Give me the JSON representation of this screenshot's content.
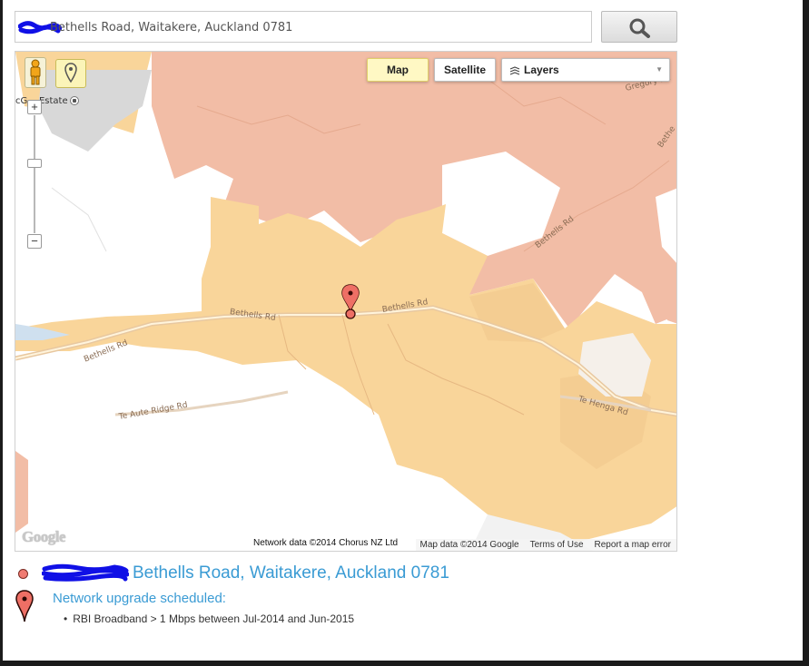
{
  "search": {
    "value": "Bethells Road, Waitakere, Auckland 0781"
  },
  "icons": {
    "search_button": "magnifier-icon",
    "pegman": "street-view-pegman-icon",
    "pin_tool": "map-pin-tool-icon",
    "layers": "layers-icon",
    "chevron": "chevron-down-icon",
    "marker": "map-marker-icon"
  },
  "map": {
    "controls": {
      "map_label": "Map",
      "satellite_label": "Satellite",
      "layers_label": "Layers",
      "zoom_in_label": "+",
      "zoom_out_label": "−",
      "active_type": "Map"
    },
    "poi": {
      "label": "cG... Estate"
    },
    "road_labels": [
      "Bethells Rd",
      "Bethells Rd",
      "Bethells Rd",
      "Bethells Rd",
      "Te Aute Ridge Rd",
      "Te Henga Rd",
      "Gregory Rd",
      "Bethe"
    ],
    "google_logo": "Google",
    "network_credit": "Network data ©2014 Chorus NZ Ltd",
    "footer": {
      "map_data": "Map data ©2014 Google",
      "terms": "Terms of Use",
      "report": "Report a map error"
    },
    "colors": {
      "upgrade_zone": "#f9d59a",
      "other_zone": "#f2bda6",
      "urban": "#d8d8d8",
      "marker": "#ee6f65"
    }
  },
  "result": {
    "address": "Bethells Road, Waitakere, Auckland 0781",
    "status": "Network upgrade scheduled:",
    "detail": "RBI Broadband > 1 Mbps between Jul-2014 and Jun-2015"
  },
  "colors": {
    "link": "#3a9bd4",
    "redaction": "#1010e6",
    "map_button_active": "#fff8c4"
  }
}
